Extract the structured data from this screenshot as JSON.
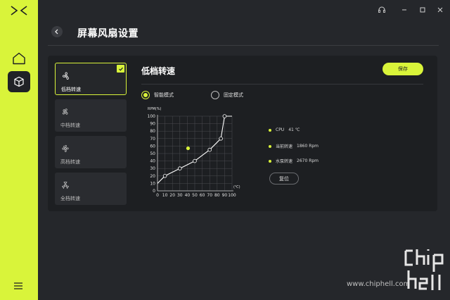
{
  "page": {
    "title": "屏幕风扇设置"
  },
  "speed_modes": [
    {
      "label": "低档转速",
      "selected": true
    },
    {
      "label": "中档转速",
      "selected": false
    },
    {
      "label": "高档转速",
      "selected": false
    },
    {
      "label": "全档转速",
      "selected": false
    }
  ],
  "section": {
    "title": "低档转速",
    "save_label": "保存",
    "reset_label": "复位"
  },
  "control_mode": {
    "smart_label": "智能模式",
    "fixed_label": "固定模式",
    "selected": "smart"
  },
  "status": [
    {
      "name": "CPU",
      "value": "41 ℃"
    },
    {
      "name": "当前转速",
      "value": "1860 Rpm"
    },
    {
      "name": "水泵转速",
      "value": "2670 Rpm"
    }
  ],
  "chart_data": {
    "type": "line",
    "ylabel": "RPM(%)",
    "xlabel": "(℃)",
    "xlim": [
      0,
      100
    ],
    "ylim": [
      0,
      100
    ],
    "x_ticks": [
      0,
      10,
      20,
      30,
      40,
      50,
      60,
      70,
      80,
      90,
      100
    ],
    "y_ticks": [
      0,
      10,
      20,
      30,
      40,
      50,
      60,
      70,
      80,
      90,
      100
    ],
    "grid": true,
    "curve": {
      "x": [
        0,
        10,
        30,
        50,
        70,
        85,
        90,
        100
      ],
      "y": [
        10,
        20,
        30,
        40,
        55,
        70,
        100,
        100
      ]
    },
    "control_points": {
      "x": [
        10,
        30,
        50,
        70,
        85,
        90
      ],
      "y": [
        20,
        30,
        40,
        55,
        70,
        100
      ]
    },
    "current_point": {
      "x": 41,
      "y": 57
    }
  },
  "watermark": {
    "url": "www.chiphell.com"
  },
  "colors": {
    "accent": "#d9f43a",
    "background": "#25272b",
    "panel": "#1d1f22"
  }
}
